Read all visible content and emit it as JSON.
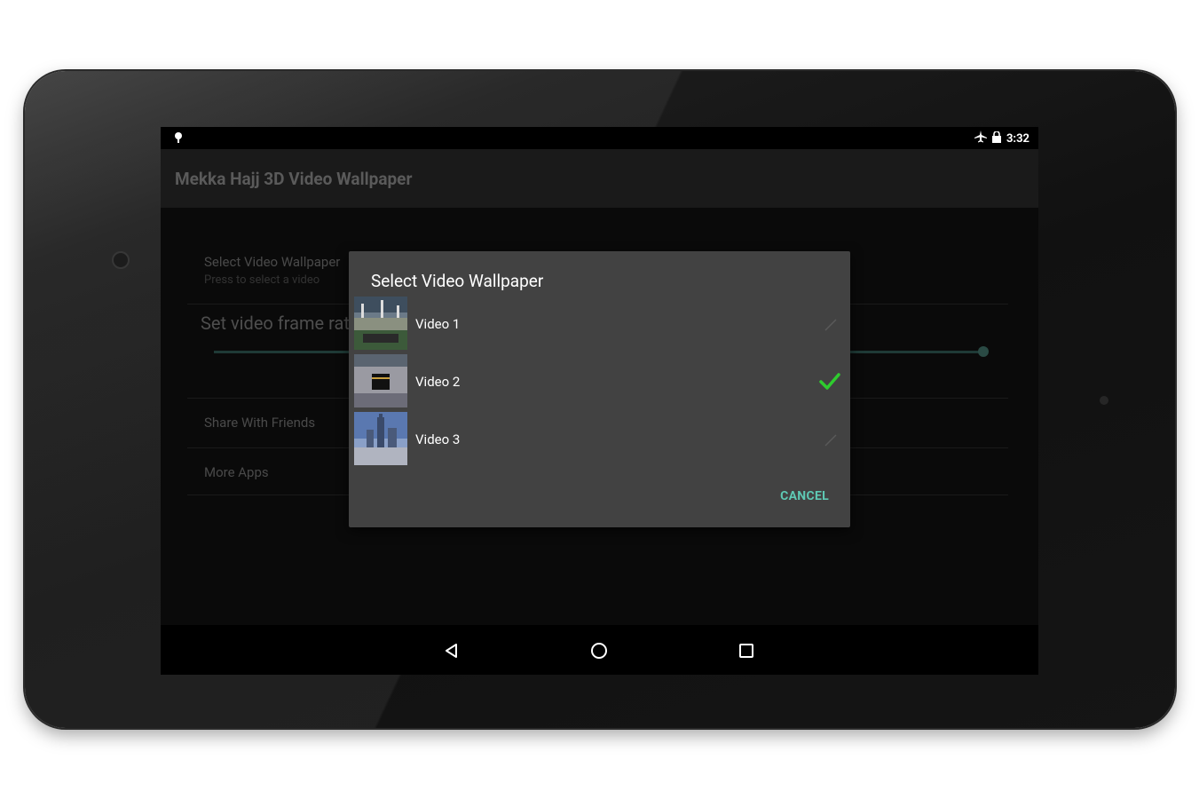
{
  "statusbar": {
    "time": "3:32"
  },
  "app": {
    "title": "Mekka Hajj 3D Video Wallpaper"
  },
  "preferences": {
    "select_video_title": "Select Video Wallpaper",
    "select_video_summary": "Press to select a video",
    "frame_rate_title": "Set video frame rate",
    "frame_rate_level": 1.0,
    "share_title": "Share With Friends",
    "more_apps_title": "More Apps"
  },
  "dialog": {
    "title": "Select Video Wallpaper",
    "items": [
      {
        "label": "Video 1",
        "selected": false
      },
      {
        "label": "Video 2",
        "selected": true
      },
      {
        "label": "Video 3",
        "selected": false
      }
    ],
    "cancel_label": "CANCEL"
  },
  "colors": {
    "accent": "#5ec9b4",
    "check": "#2ecc2e",
    "dialog_bg": "#424242"
  },
  "icons": {
    "status_left": "notification-pin-icon",
    "status_right": [
      "airplane-icon",
      "lock-icon"
    ],
    "nav": [
      "back-icon",
      "home-icon",
      "recents-icon"
    ]
  }
}
